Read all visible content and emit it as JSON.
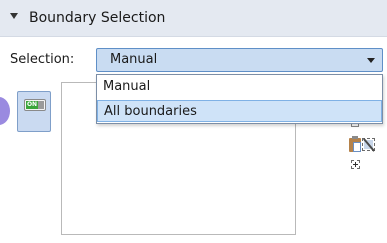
{
  "section": {
    "title": "Boundary Selection",
    "expand_icon": "chevron-down-icon"
  },
  "selection": {
    "label": "Selection:",
    "current_value": "Manual",
    "options": [
      "Manual",
      "All boundaries"
    ],
    "highlighted_option": "All boundaries"
  },
  "toggle": {
    "on_text": "ON",
    "icon": "toggle-on-icon",
    "state": "on"
  },
  "tools": {
    "icons": [
      "clear-selection-icon",
      "paste-selection-icon",
      "deselect-all-icon",
      "zoom-to-selection-icon"
    ]
  },
  "colors": {
    "header_bg": "#e4e9f1",
    "select_bg": "#c9dcf2",
    "highlight_bg": "#cfe3f8",
    "toggle_green": "#3aa53a"
  }
}
